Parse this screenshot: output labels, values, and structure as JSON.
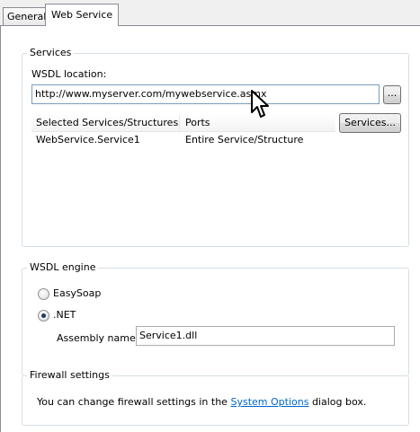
{
  "tabs": [
    {
      "label": "General",
      "active": false
    },
    {
      "label": "Web Service",
      "active": true
    }
  ],
  "services": {
    "title": "Services",
    "wsdl_label": "WSDL location:",
    "wsdl_value": "http://www.myserver.com/mywebservice.asmx",
    "browse_label": "...",
    "services_button": "Services...",
    "columns": [
      "Selected Services/Structures",
      "Ports"
    ],
    "rows": [
      {
        "service": "WebService.Service1",
        "port": "Entire Service/Structure"
      }
    ]
  },
  "engine": {
    "title": "WSDL engine",
    "options": [
      {
        "label": "EasySoap",
        "selected": false
      },
      {
        "label": ".NET",
        "selected": true
      }
    ],
    "assembly_label": "Assembly name:",
    "assembly_value": "Service1.dll"
  },
  "firewall": {
    "title": "Firewall settings",
    "text_before": "You can change firewall settings in the",
    "link": "System Options",
    "text_after": "dialog box."
  }
}
